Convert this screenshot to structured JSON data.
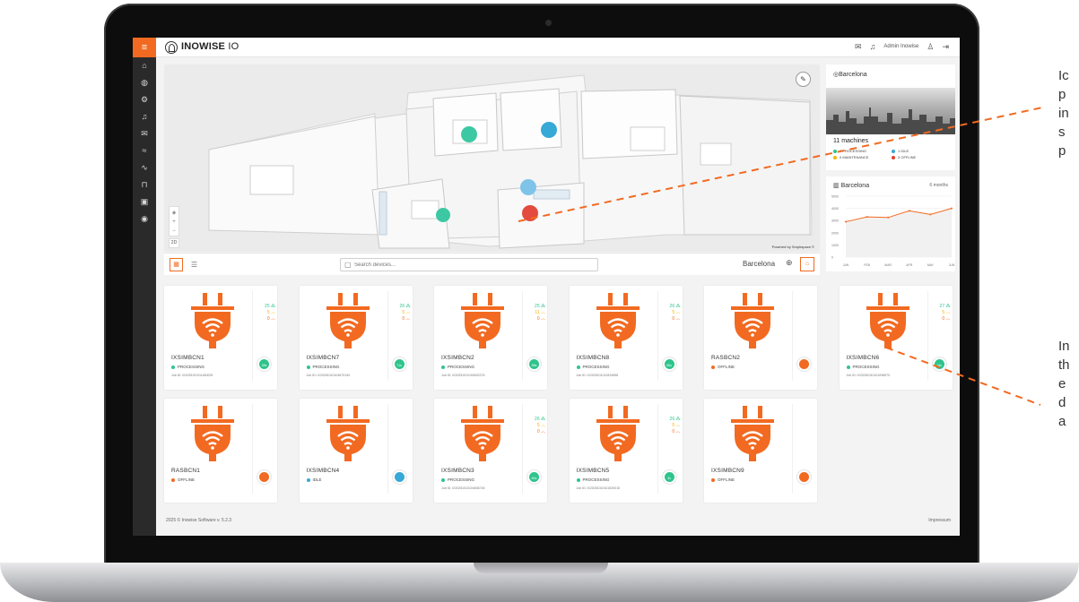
{
  "brand": {
    "prefix": "INOWISE",
    "suffix": " IO"
  },
  "topbar": {
    "user": "Admin Inowise"
  },
  "sidebar": {
    "menu_icon": "≡",
    "icons": [
      "home-icon",
      "globe-icon",
      "settings-icon",
      "bell-icon",
      "mail-icon",
      "wifi-icon",
      "activity-icon",
      "lock-icon",
      "machine-icon",
      "location-icon"
    ]
  },
  "map": {
    "powered_by": "Powered by Smplrspace ©",
    "view_2d": "2D"
  },
  "location_panel": {
    "city": "Barcelona",
    "machines": "11 machines",
    "statuses": [
      {
        "label": "7 PROCESSING",
        "color": "#2ec48c"
      },
      {
        "label": "1 IDLE",
        "color": "#36a9d6"
      },
      {
        "label": "0 MAINTENANCE",
        "color": "#f4b400"
      },
      {
        "label": "3 OFFLINE",
        "color": "#e2402e"
      }
    ]
  },
  "chart_panel": {
    "title": "Barcelona",
    "range": "6 months",
    "chart_data": {
      "type": "line",
      "categories": [
        "JAN",
        "FEB",
        "MAR",
        "APR",
        "MAY",
        "JUN"
      ],
      "values": [
        2900,
        3300,
        3250,
        3800,
        3500,
        4000
      ],
      "ylim": [
        0,
        5000
      ],
      "yticks": [
        "5000",
        "4000",
        "3000",
        "2000",
        "1000",
        "0"
      ]
    }
  },
  "toolbar": {
    "search_placeholder": "Search devices...",
    "location": "Barcelona"
  },
  "devices": [
    {
      "name": "IXSIMBCN1",
      "status": "PROCESSING",
      "status_color": "#2ec48c",
      "job": "Job ID: IX2025101011450025",
      "stats": [
        "25 ⁂",
        "5 ︿",
        "0 ︿"
      ],
      "badge": "38s"
    },
    {
      "name": "IXSIMBCN7",
      "status": "PROCESSING",
      "status_color": "#2ec48c",
      "job": "Job ID: IX20251010104670194",
      "stats": [
        "26 ⁂",
        "5 ︿",
        "0 ︿"
      ],
      "badge": "71s"
    },
    {
      "name": "IXSIMBCN2",
      "status": "PROCESSING",
      "status_color": "#2ec48c",
      "job": "Job ID: IX20251010150532276",
      "stats": [
        "25 ⁂",
        "11 ︿",
        "0 ︿"
      ],
      "badge": "58s"
    },
    {
      "name": "IXSIMBCN8",
      "status": "PROCESSING",
      "status_color": "#2ec48c",
      "job": "Job ID: IX2025101012819558",
      "stats": [
        "26 ⁂",
        "5 ︿",
        "0 ︿"
      ],
      "badge": "56s"
    },
    {
      "name": "RASBCN2",
      "status": "OFFLINE",
      "status_color": "#f26a21",
      "job": "",
      "stats": [],
      "badge": ""
    },
    {
      "name": "IXSIMBCN6",
      "status": "PROCESSING",
      "status_color": "#2ec48c",
      "job": "Job ID: IX20251010101098570",
      "stats": [
        "27 ⁂",
        "5 ︿",
        "0 ︿"
      ],
      "badge": "14s"
    },
    {
      "name": "RASBCN1",
      "status": "OFFLINE",
      "status_color": "#f26a21",
      "job": "",
      "stats": [],
      "badge": ""
    },
    {
      "name": "IXSIMBCN4",
      "status": "IDLE",
      "status_color": "#36a9d6",
      "job": "",
      "stats": [],
      "badge": ""
    },
    {
      "name": "IXSIMBCN3",
      "status": "PROCESSING",
      "status_color": "#2ec48c",
      "job": "Job ID: IX20251010104536749",
      "stats": [
        "26 ⁂",
        "5 ︿",
        "0 ︿"
      ],
      "badge": "60s"
    },
    {
      "name": "IXSIMBCN5",
      "status": "PROCESSING",
      "status_color": "#2ec48c",
      "job": "Job ID: IX20251010101920015",
      "stats": [
        "26 ⁂",
        "5 ︿",
        "0 ︿"
      ],
      "badge": "3s"
    },
    {
      "name": "IXSIMBCN9",
      "status": "OFFLINE",
      "status_color": "#f26a21",
      "job": "",
      "stats": [],
      "badge": ""
    }
  ],
  "footer": {
    "left": "2025 © Inowise Software v. 5.2.3",
    "right": "Impressum"
  },
  "callouts": {
    "top": [
      "Ic",
      "p",
      "in",
      "s",
      "p"
    ],
    "bottom": [
      "In",
      "th",
      "e",
      "d",
      "a"
    ]
  }
}
